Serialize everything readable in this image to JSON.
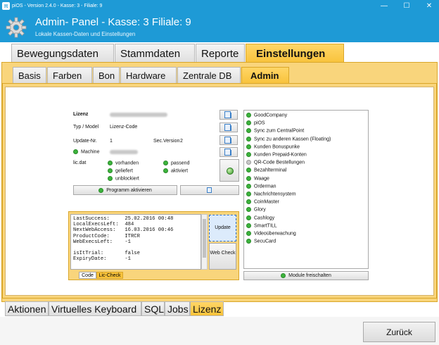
{
  "window": {
    "title": "piOS - Version 2.4.0 - Kasse: 3 - Filiale: 9",
    "app_icon": "pi-icon"
  },
  "header": {
    "title": "Admin- Panel - Kasse: 3 Filiale: 9",
    "subtitle": "Lokale Kassen-Daten und Einstellungen"
  },
  "main_tabs": [
    {
      "label": "Bewegungsdaten"
    },
    {
      "label": "Stammdaten"
    },
    {
      "label": "Reporte"
    },
    {
      "label": "Einstellungen",
      "active": true
    }
  ],
  "sub_tabs": [
    {
      "label": "Basis"
    },
    {
      "label": "Farben"
    },
    {
      "label": "Bon"
    },
    {
      "label": "Hardware"
    },
    {
      "label": "Zentrale DB"
    },
    {
      "label": "Admin",
      "active": true
    }
  ],
  "license": {
    "lizenz_label": "Lizenz",
    "typ_label": "Typ / Model",
    "typ_value": "Lizenz-Code",
    "update_label": "Update-Nr.",
    "update_value": "1",
    "secversion_label": "Sec.Version",
    "secversion_value": "2",
    "machine_label": "Machine",
    "licdat_label": "lic.dat",
    "status": {
      "vorhanden": "vorhanden",
      "passend": "passend",
      "geliefert": "geliefert",
      "aktiviert": "aktiviert",
      "unblockiert": "unblockiert"
    },
    "activate_button": "Programm aktivieren"
  },
  "code_panel": {
    "lines": [
      "LastSuccess:     25.02.2016 00:48",
      "LocalExecsLeft:  484",
      "NextWebAccess:   16.03.2016 00:46",
      "ProductCode:     ITRCR",
      "WebExecsLeft:    -1",
      "",
      "isItTrial:       false",
      "ExpiryDate:      -1"
    ],
    "update_button": "Update",
    "webcheck_button": "Web Check",
    "tabs": [
      "Code",
      "Lic-Check"
    ]
  },
  "modules": {
    "items": [
      {
        "label": "GoodCompany",
        "status": "green"
      },
      {
        "label": "piOS",
        "status": "green"
      },
      {
        "label": "Sync zum CentralPoint",
        "status": "green"
      },
      {
        "label": "Sync zu anderen Kassen (Floating)",
        "status": "green"
      },
      {
        "label": "Kunden Bonuspunke",
        "status": "green"
      },
      {
        "label": "Kunden Prepaid-Konten",
        "status": "green"
      },
      {
        "label": "QR-Code Bestellungen",
        "status": "gray"
      },
      {
        "label": "Bezahlterminal",
        "status": "green"
      },
      {
        "label": "Waage",
        "status": "green"
      },
      {
        "label": "Orderman",
        "status": "green"
      },
      {
        "label": "Nachrichtensystem",
        "status": "green"
      },
      {
        "label": "CoinMaster",
        "status": "green"
      },
      {
        "label": "Glory",
        "status": "green"
      },
      {
        "label": "Cashlogy",
        "status": "green"
      },
      {
        "label": "SmartTILL",
        "status": "green"
      },
      {
        "label": "Videoüberwachung",
        "status": "green"
      },
      {
        "label": "SecuCard",
        "status": "green"
      }
    ],
    "unlock_button": "Module freischalten"
  },
  "bottom_tabs": [
    {
      "label": "Aktionen"
    },
    {
      "label": "Virtuelles Keyboard"
    },
    {
      "label": "SQL"
    },
    {
      "label": "Jobs"
    },
    {
      "label": "Lizenz",
      "active": true
    }
  ],
  "footer": {
    "back_button": "Zurück"
  },
  "colors": {
    "header_blue": "#1e9ad6",
    "accent_yellow": "#f9d57c",
    "active_tab": "#f8c23a",
    "status_green": "#3cb43c"
  }
}
